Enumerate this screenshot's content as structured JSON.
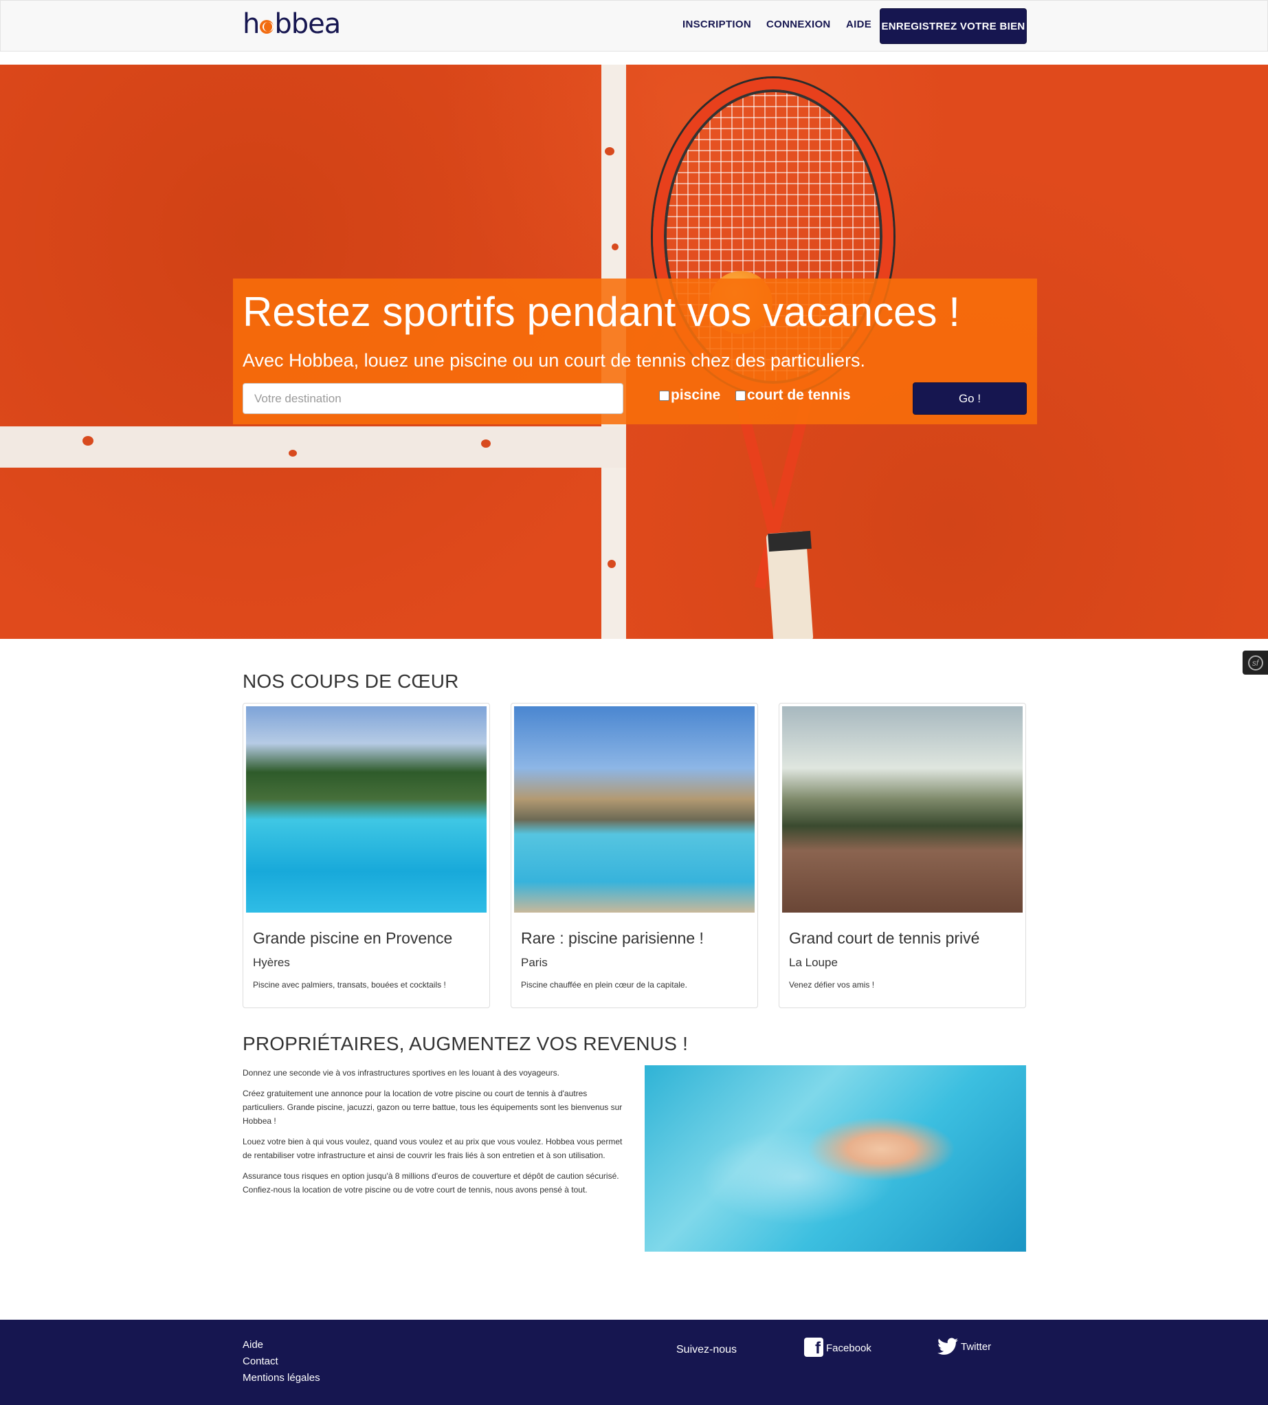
{
  "navbar": {
    "logo_text": "hobbea",
    "links": [
      "INSCRIPTION",
      "CONNEXION",
      "AIDE"
    ],
    "cta_label": "ENREGISTREZ VOTRE BIEN"
  },
  "hero": {
    "title": "Restez sportifs pendant vos vacances !",
    "subtitle": "Avec Hobbea, louez une piscine ou un court de tennis chez des particuliers.",
    "search_placeholder": "Votre destination",
    "checkboxes": [
      {
        "label": "piscine",
        "checked": false
      },
      {
        "label": "court de tennis",
        "checked": false
      }
    ],
    "go_label": "Go !"
  },
  "featured": {
    "title": "NOS COUPS DE CŒUR",
    "cards": [
      {
        "title": "Grande piscine en Provence",
        "city": "Hyères",
        "description": "Piscine avec palmiers, transats, bouées et cocktails !"
      },
      {
        "title": "Rare : piscine parisienne !",
        "city": "Paris",
        "description": "Piscine chauffée en plein cœur de la capitale."
      },
      {
        "title": "Grand court de tennis privé",
        "city": "La Loupe",
        "description": "Venez défier vos amis !"
      }
    ]
  },
  "owners": {
    "title": "PROPRIÉTAIRES, AUGMENTEZ VOS REVENUS !",
    "paragraphs": [
      "Donnez une seconde vie à vos infrastructures sportives en les louant à des voyageurs.",
      "Créez gratuitement une annonce pour la location de votre piscine ou court de tennis à d'autres particuliers. Grande piscine, jacuzzi, gazon ou terre battue, tous les équipements sont les bienvenus sur Hobbea !",
      "Louez votre bien à qui vous voulez, quand vous voulez et au prix que vous voulez. Hobbea vous permet de rentabiliser votre infrastructure et ainsi de couvrir les frais liés à son entretien et à son utilisation.",
      "Assurance tous risques en option jusqu'à 8 millions d'euros de couverture et dépôt de caution sécurisé. Confiez-nous la location de votre piscine ou de votre court de tennis, nous avons pensé à tout."
    ]
  },
  "footer": {
    "links": [
      "Aide",
      "Contact",
      "Mentions légales"
    ],
    "follow_label": "Suivez-nous",
    "facebook_label": "Facebook",
    "twitter_label": "Twitter"
  },
  "colors": {
    "brand_navy": "#161650",
    "hero_orange": "#f86e0a",
    "court_clay": "#e04a1c"
  },
  "icons": [
    "facebook-icon",
    "twitter-icon",
    "symfony-toolbar-icon"
  ]
}
